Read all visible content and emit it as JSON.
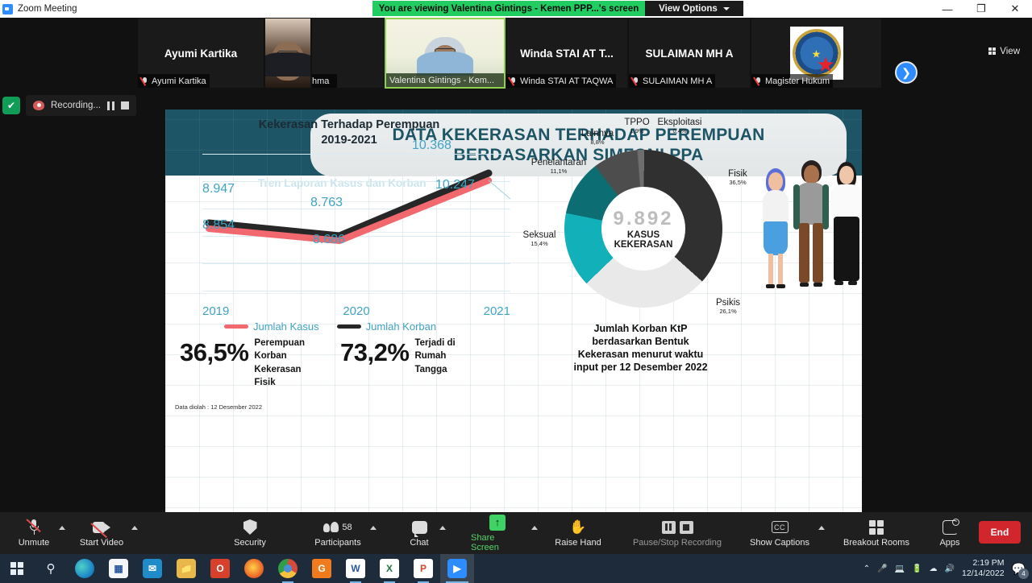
{
  "window": {
    "title": "Zoom Meeting",
    "app_icon": "zoom-icon",
    "share_banner": "You are viewing Valentina Gintings - Kemen PPP...'s screen",
    "view_options": "View Options",
    "minimize": "—",
    "restore": "❐",
    "close": "✕",
    "view_button": "View"
  },
  "participants": [
    {
      "display_name": "Ayumi Kartika",
      "name_bar": "Ayumi Kartika",
      "muted": true,
      "video_on": false,
      "speaking": false
    },
    {
      "display_name": "Yulia Rahma",
      "name_bar": "Yulia Rahma",
      "muted": true,
      "video_on": true,
      "speaking": false
    },
    {
      "display_name": "Valentina Gintings - Kemen...",
      "name_bar": "Valentina Gintings - Kem...",
      "muted": true,
      "video_on": true,
      "speaking": true
    },
    {
      "display_name": "Winda STAI AT T...",
      "name_bar": "Winda STAI AT TAQWA",
      "muted": true,
      "video_on": false,
      "speaking": false
    },
    {
      "display_name": "SULAIMAN MH A",
      "name_bar": "SULAIMAN MH A",
      "muted": true,
      "video_on": false,
      "speaking": false
    },
    {
      "display_name": "Magister Hukum",
      "name_bar": "Magister Hukum",
      "muted": true,
      "video_on": false,
      "speaking": false
    }
  ],
  "next_page_icon": "chevron-right-icon",
  "recording": {
    "security_icon": "shield-check-icon",
    "label": "Recording...",
    "pause_icon": "pause-icon",
    "stop_icon": "stop-icon"
  },
  "slide": {
    "title_line1": "DATA KEKERASAN TERHADAP PEREMPUAN",
    "title_line2": "BERDASARKAN SIMFONI PPA",
    "section_heading": "Tren Laporan Kasus dan Korban",
    "footnote": "Data diolah : 12 Desember 2022",
    "donut_caption_line1": "Jumlah Korban KtP",
    "donut_caption_line2": "berdasarkan Bentuk",
    "donut_caption_line3": "Kekerasan  menurut waktu",
    "donut_caption_line4": "input per 12 Desember 2022",
    "stats": [
      {
        "value": "36,5%",
        "desc_line1": "Perempuan",
        "desc_line2": "Korban",
        "desc_line3": "Kekerasan",
        "desc_line4": "Fisik"
      },
      {
        "value": "73,2%",
        "desc_line1": "Terjadi di",
        "desc_line2": "Rumah",
        "desc_line3": "Tangga",
        "desc_line4": ""
      }
    ]
  },
  "chart_data": [
    {
      "type": "line",
      "title": "Kekerasan Terhadap Perempuan 2019-2021",
      "title_line1": "Kekerasan Terhadap Perempuan",
      "title_line2": "2019-2021",
      "categories": [
        "2019",
        "2020",
        "2021"
      ],
      "series": [
        {
          "name": "Jumlah Kasus",
          "color": "#f2686f",
          "values": [
            8854,
            8686,
            10247
          ],
          "labels": [
            "8.854",
            "8.686",
            "10.247"
          ]
        },
        {
          "name": "Jumlah Korban",
          "color": "#272727",
          "values": [
            8947,
            8763,
            10368
          ],
          "labels": [
            "8.947",
            "8.763",
            "10.368"
          ]
        }
      ],
      "xlabel": "",
      "ylabel": "",
      "ylim": [
        8000,
        11000
      ],
      "grid": true,
      "legend_position": "bottom"
    },
    {
      "type": "pie",
      "subtype": "donut",
      "title": "Jumlah Korban KtP berdasarkan Bentuk Kekerasan menurut waktu input per 12 Desember 2022",
      "center_value": "9.892",
      "center_label_line1": "KASUS",
      "center_label_line2": "KEKERASAN",
      "slices": [
        {
          "label": "Fisik",
          "percent": "36,5%",
          "value": 36.5,
          "color": "#303030"
        },
        {
          "label": "Psikis",
          "percent": "26,1%",
          "value": 26.1,
          "color": "#e9e9e9"
        },
        {
          "label": "Seksual",
          "percent": "15,4%",
          "value": 15.4,
          "color": "#12b0b8"
        },
        {
          "label": "Penelantaran",
          "percent": "11,1%",
          "value": 11.1,
          "color": "#0c6e72"
        },
        {
          "label": "Lainnya",
          "percent": "8,8%",
          "value": 8.8,
          "color": "#4d4d4d"
        },
        {
          "label": "TPPO",
          "percent": "1,9%",
          "value": 1.9,
          "color": "#6e6e6e"
        },
        {
          "label": "Eksploitasi",
          "percent": "0,4%",
          "value": 0.4,
          "color": "#9c9c9c"
        }
      ],
      "legend_position": "around"
    }
  ],
  "toolbar": {
    "items": [
      {
        "label": "Unmute",
        "icon": "microphone-muted-icon",
        "has_caret": true,
        "state": "normal"
      },
      {
        "label": "Start Video",
        "icon": "camera-off-icon",
        "has_caret": true,
        "state": "normal"
      },
      {
        "label": "Security",
        "icon": "shield-icon",
        "has_caret": false,
        "state": "normal"
      },
      {
        "label": "Participants",
        "icon": "participants-icon",
        "has_caret": true,
        "state": "normal",
        "badge": "58"
      },
      {
        "label": "Chat",
        "icon": "chat-bubble-icon",
        "has_caret": true,
        "state": "normal"
      },
      {
        "label": "Share Screen",
        "icon": "share-screen-icon",
        "has_caret": true,
        "state": "active"
      },
      {
        "label": "Raise Hand",
        "icon": "raise-hand-icon",
        "has_caret": false,
        "state": "normal"
      },
      {
        "label": "Pause/Stop Recording",
        "icon": "pause-stop-recording-icon",
        "has_caret": false,
        "state": "dim"
      },
      {
        "label": "Show Captions",
        "icon": "closed-caption-icon",
        "has_caret": true,
        "state": "normal"
      },
      {
        "label": "Breakout Rooms",
        "icon": "breakout-rooms-icon",
        "has_caret": false,
        "state": "normal"
      },
      {
        "label": "Apps",
        "icon": "apps-icon",
        "has_caret": false,
        "state": "normal"
      }
    ],
    "end_label": "End"
  },
  "taskbar": {
    "start_icon": "windows-start-icon",
    "search_icon": "search-icon",
    "apps": [
      {
        "name": "microsoft-edge",
        "glyph": "e",
        "color": "#1f8bc9"
      },
      {
        "name": "microsoft-store",
        "glyph": "⊞",
        "color": "#f2f2f2"
      },
      {
        "name": "mail",
        "glyph": "✉",
        "color": "#1f8bc9"
      },
      {
        "name": "file-explorer",
        "glyph": "▤",
        "color": "#e8b94a"
      },
      {
        "name": "microsoft-office",
        "glyph": "O",
        "color": "#d7402a"
      },
      {
        "name": "mozilla-firefox",
        "glyph": "●",
        "color": "#f0742a"
      },
      {
        "name": "google-chrome",
        "glyph": "◉",
        "color": "#2f9e44"
      },
      {
        "name": "gom-player",
        "glyph": "G",
        "color": "#f07a1e"
      },
      {
        "name": "microsoft-word",
        "glyph": "W",
        "color": "#2b579a"
      },
      {
        "name": "microsoft-excel",
        "glyph": "X",
        "color": "#217346"
      },
      {
        "name": "microsoft-powerpoint",
        "glyph": "P",
        "color": "#d24726"
      },
      {
        "name": "zoom",
        "glyph": "■",
        "color": "#2d8cff"
      }
    ],
    "tray_icons": [
      "chevron-up-icon",
      "microphone-icon",
      "display-icon",
      "battery-icon",
      "wifi-icon",
      "volume-icon"
    ],
    "time": "2:19 PM",
    "date": "12/14/2022",
    "notification_count": "4"
  }
}
